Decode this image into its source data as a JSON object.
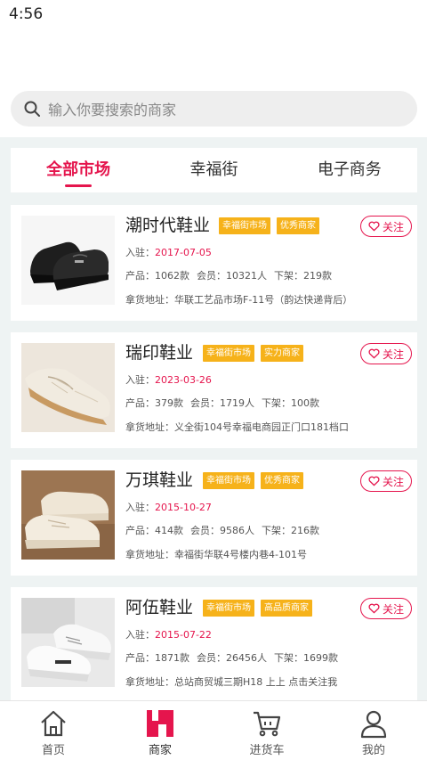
{
  "status_bar": {
    "time": "4:56"
  },
  "search": {
    "placeholder": "输入你要搜索的商家"
  },
  "tabs": [
    {
      "label": "全部市场",
      "active": true
    },
    {
      "label": "幸福街",
      "active": false
    },
    {
      "label": "电子商务",
      "active": false
    }
  ],
  "shops": [
    {
      "name": "潮时代鞋业",
      "badges": [
        "幸福街市场",
        "优秀商家"
      ],
      "follow": "关注",
      "joined_label": "入驻：",
      "joined_date": "2017-07-05",
      "products_label": "产品：",
      "products": "1062款",
      "members_label": "会员：",
      "members": "10321人",
      "shelf_label": "下架：",
      "shelf": "219款",
      "address_label": "拿货地址：",
      "address": "华联工艺品市场F-11号（韵达快递背后）"
    },
    {
      "name": "瑞印鞋业",
      "badges": [
        "幸福街市场",
        "实力商家"
      ],
      "follow": "关注",
      "joined_label": "入驻：",
      "joined_date": "2023-03-26",
      "products_label": "产品：",
      "products": "379款",
      "members_label": "会员：",
      "members": "1719人",
      "shelf_label": "下架：",
      "shelf": "100款",
      "address_label": "拿货地址：",
      "address": "义全街104号幸福电商园正门口181档口"
    },
    {
      "name": "万琪鞋业",
      "badges": [
        "幸福街市场",
        "优秀商家"
      ],
      "follow": "关注",
      "joined_label": "入驻：",
      "joined_date": "2015-10-27",
      "products_label": "产品：",
      "products": "414款",
      "members_label": "会员：",
      "members": "9586人",
      "shelf_label": "下架：",
      "shelf": "216款",
      "address_label": "拿货地址：",
      "address": "幸福街华联4号楼内巷4-101号"
    },
    {
      "name": "阿伍鞋业",
      "badges": [
        "幸福街市场",
        "高品质商家"
      ],
      "follow": "关注",
      "joined_label": "入驻：",
      "joined_date": "2015-07-22",
      "products_label": "产品：",
      "products": "1871款",
      "members_label": "会员：",
      "members": "26456人",
      "shelf_label": "下架：",
      "shelf": "1699款",
      "address_label": "拿货地址：",
      "address": "总站商贸城三期H18 上上 点击关注我"
    }
  ],
  "bottom_nav": [
    {
      "label": "首页",
      "icon": "home-icon",
      "active": false
    },
    {
      "label": "商家",
      "icon": "shop-icon",
      "active": true
    },
    {
      "label": "进货车",
      "icon": "cart-icon",
      "active": false
    },
    {
      "label": "我的",
      "icon": "user-icon",
      "active": false
    }
  ],
  "colors": {
    "accent": "#e5154d",
    "badge": "#f6b21a"
  }
}
